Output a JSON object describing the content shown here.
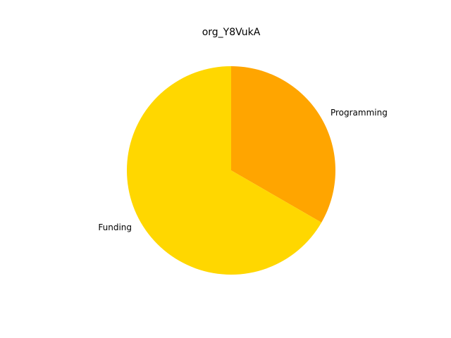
{
  "chart_data": {
    "type": "pie",
    "title": "org_Y8VukA",
    "start_angle_deg": 90,
    "direction": "clockwise",
    "slices": [
      {
        "label": "Programming",
        "value": 0.3333,
        "color": "#FFA500"
      },
      {
        "label": "Funding",
        "value": 0.6667,
        "color": "#FFD700"
      }
    ]
  }
}
